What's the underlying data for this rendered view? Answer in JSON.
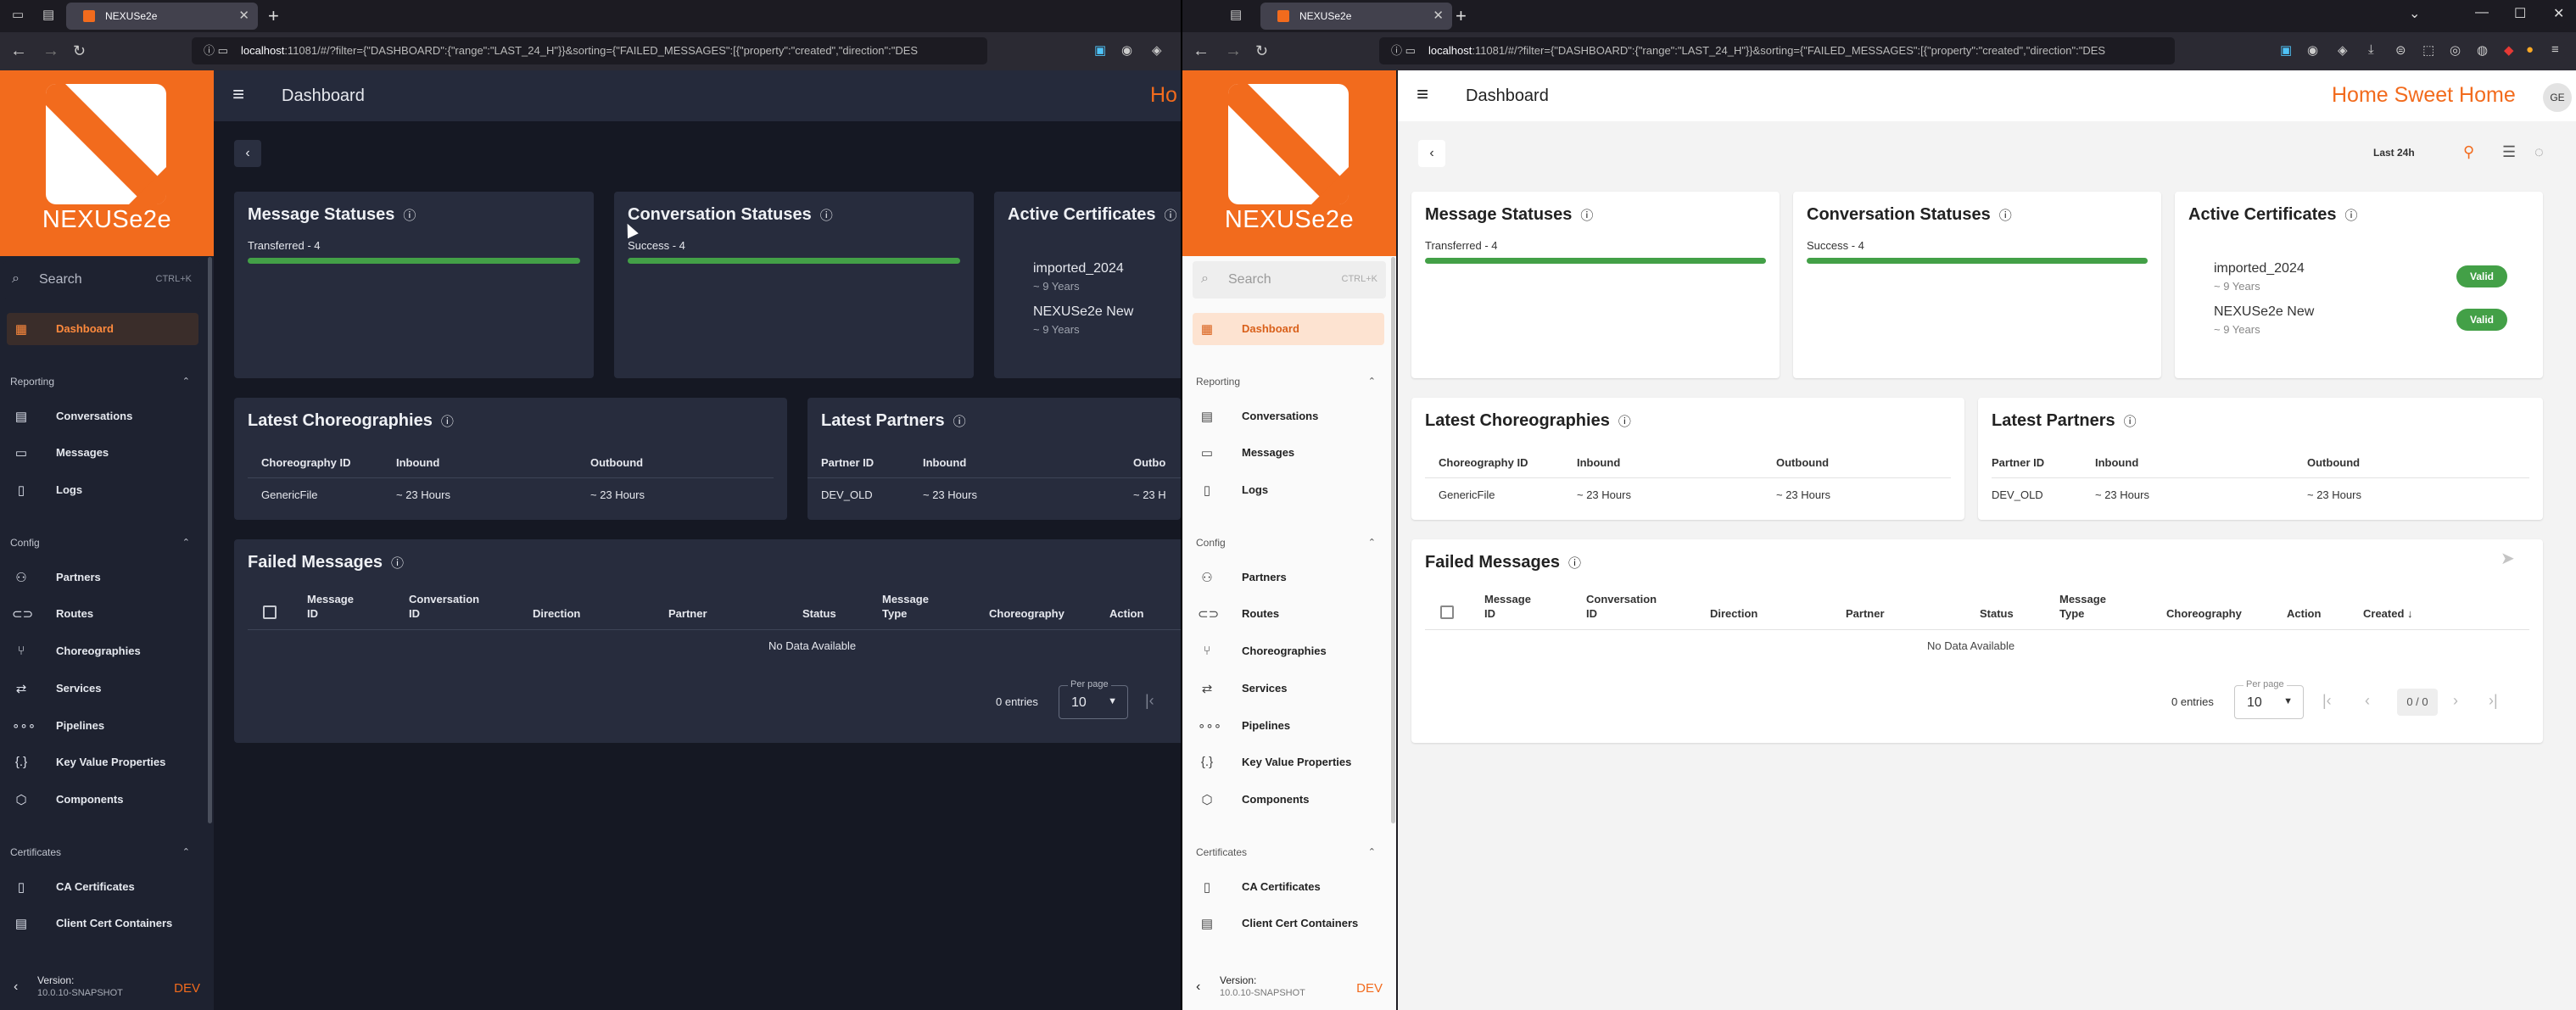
{
  "browser": {
    "tab_title": "NEXUSe2e",
    "url_host": "localhost",
    "url_rest": ":11081/#/?filter={\"DASHBOARD\":{\"range\":\"LAST_24_H\"}}&sorting={\"FAILED_MESSAGES\":[{\"property\":\"created\",\"direction\":\"DES",
    "new_tab": "+"
  },
  "app": {
    "logo_text": "NEXUSe2e",
    "page_title": "Dashboard",
    "home_title": "Home Sweet Home",
    "home_title_cut": "Ho",
    "avatar": "GE",
    "accent_color": "#f26b1d",
    "success_color": "#43a047"
  },
  "search": {
    "placeholder": "Search",
    "shortcut": "CTRL+K"
  },
  "sidebar": {
    "dashboard": "Dashboard",
    "reporting": {
      "title": "Reporting",
      "items": [
        "Conversations",
        "Messages",
        "Logs"
      ]
    },
    "config": {
      "title": "Config",
      "items": [
        "Partners",
        "Routes",
        "Choreographies",
        "Services",
        "Pipelines",
        "Key Value Properties",
        "Components"
      ]
    },
    "certificates": {
      "title": "Certificates",
      "items": [
        "CA Certificates",
        "Client Cert Containers"
      ]
    },
    "version_label": "Version:",
    "version_number": "10.0.10-SNAPSHOT",
    "env": "DEV"
  },
  "toolbar": {
    "range": "Last 24h"
  },
  "message_statuses": {
    "title": "Message Statuses",
    "label": "Transferred - 4",
    "fraction": 1.0
  },
  "conversation_statuses": {
    "title": "Conversation Statuses",
    "label": "Success - 4",
    "fraction": 1.0
  },
  "active_certificates": {
    "title": "Active Certificates",
    "items": [
      {
        "name": "imported_2024",
        "age": "~ 9 Years",
        "status": "Valid"
      },
      {
        "name": "NEXUSe2e New",
        "age": "~ 9 Years",
        "status": "Valid"
      }
    ]
  },
  "latest_choreographies": {
    "title": "Latest Choreographies",
    "headers": [
      "Choreography ID",
      "Inbound",
      "Outbound"
    ],
    "rows": [
      [
        "GenericFile",
        "~ 23 Hours",
        "~ 23 Hours"
      ]
    ]
  },
  "latest_partners": {
    "title": "Latest Partners",
    "headers": [
      "Partner ID",
      "Inbound",
      "Outbound"
    ],
    "outbound_cut": "Outbo",
    "rows": [
      [
        "DEV_OLD",
        "~ 23 Hours",
        "~ 23 Hours"
      ]
    ],
    "outbound_value_cut": "~ 23 H"
  },
  "failed_messages": {
    "title": "Failed Messages",
    "headers": {
      "message_id_1": "Message",
      "message_id_2": "ID",
      "conversation_id_1": "Conversation",
      "conversation_id_2": "ID",
      "direction": "Direction",
      "partner": "Partner",
      "status": "Status",
      "message_type_1": "Message",
      "message_type_2": "Type",
      "choreography": "Choreography",
      "action": "Action",
      "created": "Created"
    },
    "empty": "No Data Available",
    "entries": "0 entries",
    "per_page_label": "Per page",
    "per_page": "10",
    "page_info": "0 / 0"
  }
}
